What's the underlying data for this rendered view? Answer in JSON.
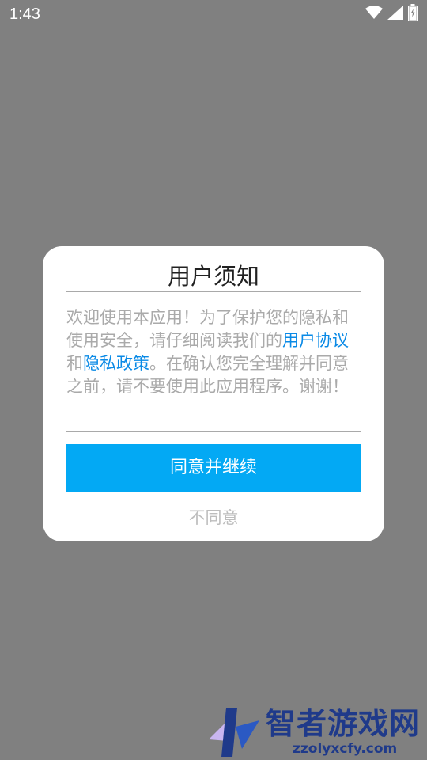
{
  "status_bar": {
    "time": "1:43",
    "icons": [
      "wifi-icon",
      "signal-icon",
      "battery-charging-icon"
    ]
  },
  "dialog": {
    "title": "用户须知",
    "body": {
      "intro": "欢迎使用本应用！为了保护您的隐私和使用安全，请仔细阅读我们的",
      "link_user_agreement": "用户协议",
      "and": "和",
      "link_privacy_policy": "隐私政策",
      "outro": "。在确认您完全理解并同意之前，请不要使用此应用程序。谢谢！"
    },
    "agree_label": "同意并继续",
    "disagree_label": "不同意"
  },
  "watermark": {
    "brand": "智者游戏网",
    "url": "zzolyxcfy.com"
  },
  "colors": {
    "overlay": "#808080",
    "accent": "#03a9f4",
    "link": "#0a8ae6",
    "body_text": "#aaaaaa",
    "watermark": "#1f3a8a"
  }
}
